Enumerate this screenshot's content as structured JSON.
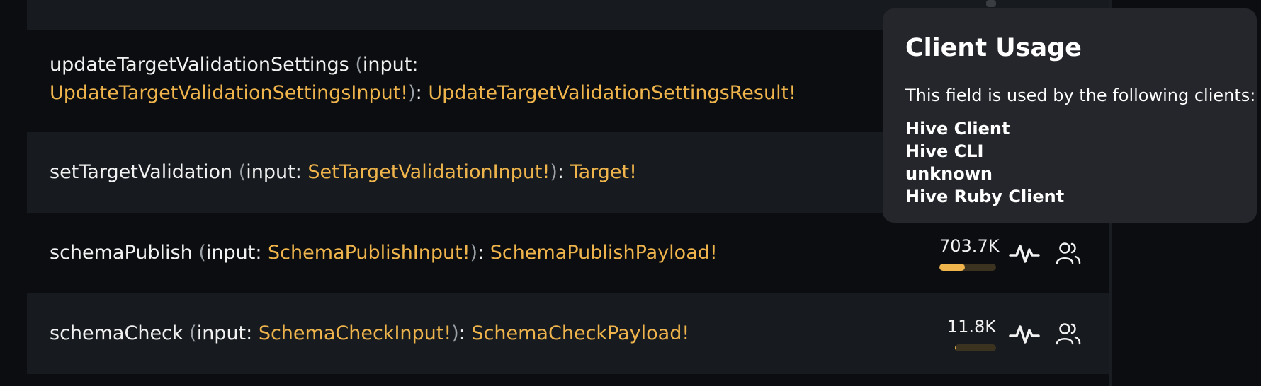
{
  "operations": [
    {
      "name": "updateTargetValidationSettings",
      "arg": "input",
      "input_type": "UpdateTargetValidationSettingsInput!",
      "return_type": "UpdateTargetValidationSettingsResult!"
    },
    {
      "name": "setTargetValidation",
      "arg": "input",
      "input_type": "SetTargetValidationInput!",
      "return_type": "Target!"
    },
    {
      "name": "schemaPublish",
      "arg": "input",
      "input_type": "SchemaPublishInput!",
      "return_type": "SchemaPublishPayload!",
      "usage_count": "703.7K",
      "usage_fraction": 0.45
    },
    {
      "name": "schemaCheck",
      "arg": "input",
      "input_type": "SchemaCheckInput!",
      "return_type": "SchemaCheckPayload!",
      "usage_count": "11.8K",
      "usage_fraction": 0.01
    }
  ],
  "punct": {
    "open": "(",
    "colon_space": ": ",
    "close": ")",
    "ret_sep": ": "
  },
  "icons": {
    "activity": "activity-icon",
    "clients": "users-icon"
  },
  "popover": {
    "title": "Client Usage",
    "description": "This field is used by the following clients:",
    "clients": [
      "Hive Client",
      "Hive CLI",
      "unknown",
      "Hive Ruby Client"
    ]
  },
  "colors": {
    "accent": "#efb54c",
    "background": "#0b0d10",
    "row_alt": "#171a1e",
    "popover": "#24262b"
  }
}
